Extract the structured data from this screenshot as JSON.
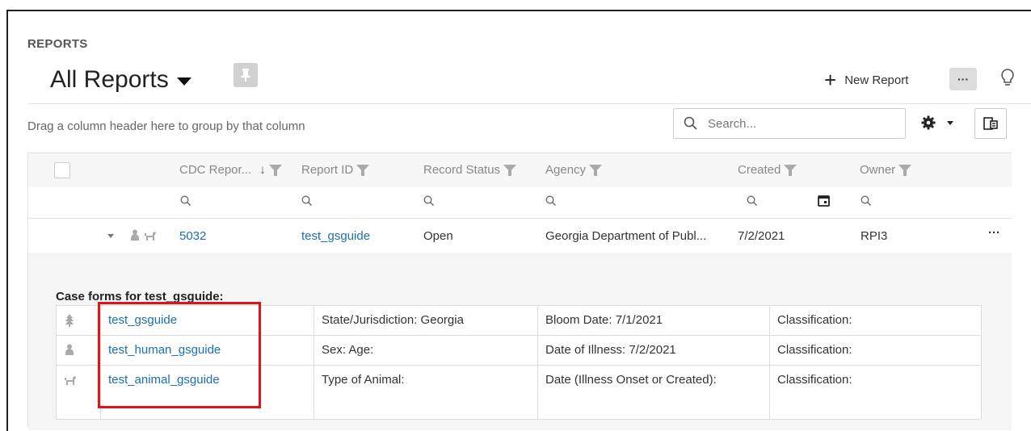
{
  "section_label": "REPORTS",
  "view_title": "All Reports",
  "toolbar": {
    "new_report_label": "New Report"
  },
  "grid": {
    "group_hint": "Drag a column header here to group by that column",
    "search_placeholder": "Search...",
    "columns": [
      "CDC Repor...",
      "Report ID",
      "Record Status",
      "Agency",
      "Created",
      "Owner"
    ],
    "sort_indicator": "↓"
  },
  "rows": [
    {
      "cdc_report": "5032",
      "report_id": "test_gsguide",
      "status": "Open",
      "agency": "Georgia Department of Publ...",
      "created": "7/2/2021",
      "owner": "RPI3",
      "more": "···"
    }
  ],
  "detail": {
    "title": "Case forms for test_gsguide:",
    "forms": [
      {
        "icon": "tree-icon",
        "name": "test_gsguide",
        "c2": "State/Jurisdiction: Georgia",
        "c3": "Bloom Date: 7/1/2021",
        "c4": "Classification:"
      },
      {
        "icon": "person-icon",
        "name": "test_human_gsguide",
        "c2": "Sex: Age:",
        "c3": "Date of Illness: 7/2/2021",
        "c4": "Classification:"
      },
      {
        "icon": "dog-icon",
        "name": "test_animal_gsguide",
        "c2": "Type of Animal:",
        "c3": "Date (Illness Onset or Created):",
        "c4": "Classification:"
      }
    ]
  },
  "colors": {
    "link": "#1a6fb5",
    "highlight": "#e0131b"
  }
}
